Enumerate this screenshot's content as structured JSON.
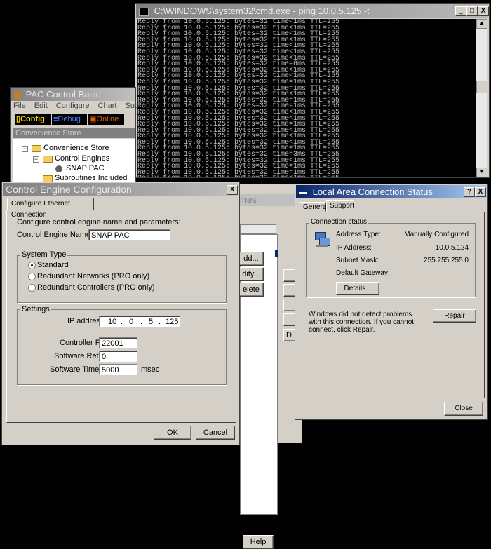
{
  "cmd": {
    "title": "C:\\WINDOWS\\system32\\cmd.exe - ping 10.0.5.125 -t",
    "lines": [
      "Reply from 10.0.5.125: bytes=32 time<1ms TTL=255",
      "Reply from 10.0.5.125: bytes=32 time<1ms TTL=255",
      "Reply from 10.0.5.125: bytes=32 time<1ms TTL=255",
      "Reply from 10.0.5.125: bytes=32 time<1ms TTL=255",
      "Reply from 10.0.5.125: bytes=32 time<1ms TTL=255",
      "Reply from 10.0.5.125: bytes=32 time<1ms TTL=255",
      "Reply from 10.0.5.125: bytes=32 time<1ms TTL=255",
      "Reply from 10.0.5.125: bytes=32 time=6ms TTL=255",
      "Reply from 10.0.5.125: bytes=32 time<1ms TTL=255",
      "Reply from 10.0.5.125: bytes=32 time<1ms TTL=255",
      "Reply from 10.0.5.125: bytes=32 time=1ms TTL=255",
      "Reply from 10.0.5.125: bytes=32 time=1ms TTL=255",
      "Reply from 10.0.5.125: bytes=32 time<1ms TTL=255",
      "Reply from 10.0.5.125: bytes=32 time=1ms TTL=255",
      "Reply from 10.0.5.125: bytes=32 time=1ms TTL=255",
      "Reply from 10.0.5.125: bytes=32 time<1ms TTL=255",
      "Reply from 10.0.5.125: bytes=32 time<1ms TTL=255",
      "Reply from 10.0.5.125: bytes=32 time=1ms TTL=255",
      "Reply from 10.0.5.125: bytes=32 time<1ms TTL=255",
      "Reply from 10.0.5.125: bytes=32 time<1ms TTL=255",
      "Reply from 10.0.5.125: bytes=32 time<1ms TTL=255",
      "Reply from 10.0.5.125: bytes=32 time=1ms TTL=255",
      "Reply from 10.0.5.125: bytes=32 time=3ms TTL=255",
      "Reply from 10.0.5.125: bytes=32 time<1ms TTL=255",
      "Reply from 10.0.5.125: bytes=32 time=1ms TTL=255",
      "Reply from 10.0.5.125: bytes=32 time=1ms TTL=255",
      "Reply from 10.0.5.125: bytes=32 time<1ms TTL=255"
    ],
    "buttons": {
      "minimize": "_",
      "maximize": "□",
      "close": "X"
    }
  },
  "pac": {
    "title": "PAC Control Basic",
    "menu": [
      "File",
      "Edit",
      "Configure",
      "Chart",
      "Subrou"
    ],
    "modes": {
      "config": "Config",
      "debug": "Debug",
      "online": "Online"
    },
    "strategy_title": "Convenience Store",
    "tree": {
      "root": "Convenience Store",
      "engines": "Control Engines",
      "engine": "SNAP PAC",
      "subroutines": "Subroutines Included"
    }
  },
  "engines_dialog": {
    "title_fragment": "ines",
    "buttons": {
      "add": "dd...",
      "modify": "dify...",
      "delete": "elete",
      "help": "Help",
      "d": "D"
    }
  },
  "cec": {
    "title": "Control Engine Configuration",
    "close": "X",
    "tab": "Configure Ethernet Connection",
    "intro": "Configure control engine name and parameters:",
    "name_label": "Control Engine Name:",
    "name_value": "SNAP PAC",
    "system_type": {
      "label": "System Type",
      "options": [
        "Standard",
        "Redundant Networks (PRO only)",
        "Redundant Controllers (PRO only)"
      ],
      "selected": 0
    },
    "settings": {
      "label": "Settings",
      "ip_label": "IP address:",
      "ip": [
        "10",
        "0",
        "5",
        "125"
      ],
      "ip_dot": ".",
      "port_label": "Controller Port:",
      "port": "22001",
      "retries_label": "Software Retries:",
      "retries": "0",
      "timeout_label": "Software Timeout:",
      "timeout": "5000",
      "timeout_unit": "msec"
    },
    "ok": "OK",
    "cancel": "Cancel"
  },
  "lacs": {
    "title": "Local Area Connection Status",
    "help": "?",
    "close": "X",
    "tabs": [
      "General",
      "Support"
    ],
    "status_label": "Connection status",
    "rows": [
      {
        "label": "Address Type:",
        "value": "Manually Configured"
      },
      {
        "label": "IP Address:",
        "value": "10.0.5.124"
      },
      {
        "label": "Subnet Mask:",
        "value": "255.255.255.0"
      },
      {
        "label": "Default Gateway:",
        "value": ""
      }
    ],
    "details": "Details...",
    "message": "Windows did not detect problems with this connection. If you cannot connect, click Repair.",
    "repair": "Repair",
    "close_button": "Close"
  }
}
